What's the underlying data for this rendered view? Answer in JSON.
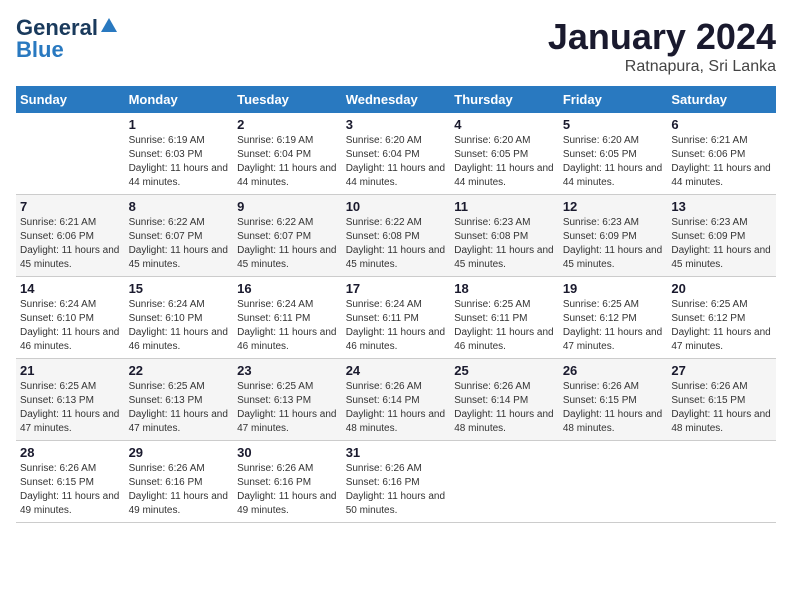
{
  "header": {
    "logo_general": "General",
    "logo_blue": "Blue",
    "title": "January 2024",
    "subtitle": "Ratnapura, Sri Lanka"
  },
  "weekdays": [
    "Sunday",
    "Monday",
    "Tuesday",
    "Wednesday",
    "Thursday",
    "Friday",
    "Saturday"
  ],
  "weeks": [
    [
      {
        "day": "",
        "sunrise": "",
        "sunset": "",
        "daylight": ""
      },
      {
        "day": "1",
        "sunrise": "Sunrise: 6:19 AM",
        "sunset": "Sunset: 6:03 PM",
        "daylight": "Daylight: 11 hours and 44 minutes."
      },
      {
        "day": "2",
        "sunrise": "Sunrise: 6:19 AM",
        "sunset": "Sunset: 6:04 PM",
        "daylight": "Daylight: 11 hours and 44 minutes."
      },
      {
        "day": "3",
        "sunrise": "Sunrise: 6:20 AM",
        "sunset": "Sunset: 6:04 PM",
        "daylight": "Daylight: 11 hours and 44 minutes."
      },
      {
        "day": "4",
        "sunrise": "Sunrise: 6:20 AM",
        "sunset": "Sunset: 6:05 PM",
        "daylight": "Daylight: 11 hours and 44 minutes."
      },
      {
        "day": "5",
        "sunrise": "Sunrise: 6:20 AM",
        "sunset": "Sunset: 6:05 PM",
        "daylight": "Daylight: 11 hours and 44 minutes."
      },
      {
        "day": "6",
        "sunrise": "Sunrise: 6:21 AM",
        "sunset": "Sunset: 6:06 PM",
        "daylight": "Daylight: 11 hours and 44 minutes."
      }
    ],
    [
      {
        "day": "7",
        "sunrise": "Sunrise: 6:21 AM",
        "sunset": "Sunset: 6:06 PM",
        "daylight": "Daylight: 11 hours and 45 minutes."
      },
      {
        "day": "8",
        "sunrise": "Sunrise: 6:22 AM",
        "sunset": "Sunset: 6:07 PM",
        "daylight": "Daylight: 11 hours and 45 minutes."
      },
      {
        "day": "9",
        "sunrise": "Sunrise: 6:22 AM",
        "sunset": "Sunset: 6:07 PM",
        "daylight": "Daylight: 11 hours and 45 minutes."
      },
      {
        "day": "10",
        "sunrise": "Sunrise: 6:22 AM",
        "sunset": "Sunset: 6:08 PM",
        "daylight": "Daylight: 11 hours and 45 minutes."
      },
      {
        "day": "11",
        "sunrise": "Sunrise: 6:23 AM",
        "sunset": "Sunset: 6:08 PM",
        "daylight": "Daylight: 11 hours and 45 minutes."
      },
      {
        "day": "12",
        "sunrise": "Sunrise: 6:23 AM",
        "sunset": "Sunset: 6:09 PM",
        "daylight": "Daylight: 11 hours and 45 minutes."
      },
      {
        "day": "13",
        "sunrise": "Sunrise: 6:23 AM",
        "sunset": "Sunset: 6:09 PM",
        "daylight": "Daylight: 11 hours and 45 minutes."
      }
    ],
    [
      {
        "day": "14",
        "sunrise": "Sunrise: 6:24 AM",
        "sunset": "Sunset: 6:10 PM",
        "daylight": "Daylight: 11 hours and 46 minutes."
      },
      {
        "day": "15",
        "sunrise": "Sunrise: 6:24 AM",
        "sunset": "Sunset: 6:10 PM",
        "daylight": "Daylight: 11 hours and 46 minutes."
      },
      {
        "day": "16",
        "sunrise": "Sunrise: 6:24 AM",
        "sunset": "Sunset: 6:11 PM",
        "daylight": "Daylight: 11 hours and 46 minutes."
      },
      {
        "day": "17",
        "sunrise": "Sunrise: 6:24 AM",
        "sunset": "Sunset: 6:11 PM",
        "daylight": "Daylight: 11 hours and 46 minutes."
      },
      {
        "day": "18",
        "sunrise": "Sunrise: 6:25 AM",
        "sunset": "Sunset: 6:11 PM",
        "daylight": "Daylight: 11 hours and 46 minutes."
      },
      {
        "day": "19",
        "sunrise": "Sunrise: 6:25 AM",
        "sunset": "Sunset: 6:12 PM",
        "daylight": "Daylight: 11 hours and 47 minutes."
      },
      {
        "day": "20",
        "sunrise": "Sunrise: 6:25 AM",
        "sunset": "Sunset: 6:12 PM",
        "daylight": "Daylight: 11 hours and 47 minutes."
      }
    ],
    [
      {
        "day": "21",
        "sunrise": "Sunrise: 6:25 AM",
        "sunset": "Sunset: 6:13 PM",
        "daylight": "Daylight: 11 hours and 47 minutes."
      },
      {
        "day": "22",
        "sunrise": "Sunrise: 6:25 AM",
        "sunset": "Sunset: 6:13 PM",
        "daylight": "Daylight: 11 hours and 47 minutes."
      },
      {
        "day": "23",
        "sunrise": "Sunrise: 6:25 AM",
        "sunset": "Sunset: 6:13 PM",
        "daylight": "Daylight: 11 hours and 47 minutes."
      },
      {
        "day": "24",
        "sunrise": "Sunrise: 6:26 AM",
        "sunset": "Sunset: 6:14 PM",
        "daylight": "Daylight: 11 hours and 48 minutes."
      },
      {
        "day": "25",
        "sunrise": "Sunrise: 6:26 AM",
        "sunset": "Sunset: 6:14 PM",
        "daylight": "Daylight: 11 hours and 48 minutes."
      },
      {
        "day": "26",
        "sunrise": "Sunrise: 6:26 AM",
        "sunset": "Sunset: 6:15 PM",
        "daylight": "Daylight: 11 hours and 48 minutes."
      },
      {
        "day": "27",
        "sunrise": "Sunrise: 6:26 AM",
        "sunset": "Sunset: 6:15 PM",
        "daylight": "Daylight: 11 hours and 48 minutes."
      }
    ],
    [
      {
        "day": "28",
        "sunrise": "Sunrise: 6:26 AM",
        "sunset": "Sunset: 6:15 PM",
        "daylight": "Daylight: 11 hours and 49 minutes."
      },
      {
        "day": "29",
        "sunrise": "Sunrise: 6:26 AM",
        "sunset": "Sunset: 6:16 PM",
        "daylight": "Daylight: 11 hours and 49 minutes."
      },
      {
        "day": "30",
        "sunrise": "Sunrise: 6:26 AM",
        "sunset": "Sunset: 6:16 PM",
        "daylight": "Daylight: 11 hours and 49 minutes."
      },
      {
        "day": "31",
        "sunrise": "Sunrise: 6:26 AM",
        "sunset": "Sunset: 6:16 PM",
        "daylight": "Daylight: 11 hours and 50 minutes."
      },
      {
        "day": "",
        "sunrise": "",
        "sunset": "",
        "daylight": ""
      },
      {
        "day": "",
        "sunrise": "",
        "sunset": "",
        "daylight": ""
      },
      {
        "day": "",
        "sunrise": "",
        "sunset": "",
        "daylight": ""
      }
    ]
  ]
}
